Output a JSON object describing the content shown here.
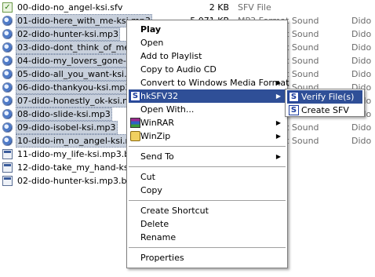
{
  "files": [
    {
      "name": "00-dido-no_angel-ksi.sfv",
      "size": "2 KB",
      "type": "SFV File",
      "artist": "",
      "icon": "sfv-file-icon",
      "selected": false
    },
    {
      "name": "01-dido-here_with_me-ksi.mp3",
      "size": "5,071 KB",
      "type": "MP3 Format Sound",
      "artist": "Dido",
      "icon": "sound-file-icon",
      "selected": true
    },
    {
      "name": "02-dido-hunter-ksi.mp3",
      "size": "",
      "type": "MP3 Format Sound",
      "artist": "Dido",
      "icon": "sound-file-icon",
      "selected": true
    },
    {
      "name": "03-dido-dont_think_of_me-ksi",
      "size": "",
      "type": "MP3 Format Sound",
      "artist": "Dido",
      "icon": "sound-file-icon",
      "selected": true
    },
    {
      "name": "04-dido-my_lovers_gone-ksi.",
      "size": "",
      "type": "MP3 Format Sound",
      "artist": "Dido",
      "icon": "sound-file-icon",
      "selected": true
    },
    {
      "name": "05-dido-all_you_want-ksi.mp",
      "size": "",
      "type": "MP3 Format Sound",
      "artist": "Dido",
      "icon": "sound-file-icon",
      "selected": true
    },
    {
      "name": "06-dido-thankyou-ksi.mp3",
      "size": "",
      "type": "MP3 Format Sound",
      "artist": "Dido",
      "icon": "sound-file-icon",
      "selected": true
    },
    {
      "name": "07-dido-honestly_ok-ksi.mp3",
      "size": "",
      "type": "MP3 Format Sound",
      "artist": "Dido",
      "icon": "sound-file-icon",
      "selected": true
    },
    {
      "name": "08-dido-slide-ksi.mp3",
      "size": "",
      "type": "MP3 Format Sound",
      "artist": "Dido",
      "icon": "sound-file-icon",
      "selected": true
    },
    {
      "name": "09-dido-isobel-ksi.mp3",
      "size": "",
      "type": "MP3 Format Sound",
      "artist": "Dido",
      "icon": "sound-file-icon",
      "selected": true
    },
    {
      "name": "10-dido-im_no_angel-ksi.mp3",
      "size": "",
      "type": "MP3 Format Sound",
      "artist": "Dido",
      "icon": "sound-file-icon",
      "selected": true
    },
    {
      "name": "11-dido-my_life-ksi.mp3.bad",
      "size": "",
      "type": "",
      "artist": "",
      "icon": "bad-file-icon",
      "selected": false
    },
    {
      "name": "12-dido-take_my_hand-ksi.mp",
      "size": "",
      "type": "",
      "artist": "",
      "icon": "bad-file-icon",
      "selected": false
    },
    {
      "name": "02-dido-hunter-ksi.mp3.bad",
      "size": "",
      "type": "",
      "artist": "",
      "icon": "bad-file-icon",
      "selected": false
    }
  ],
  "menu": {
    "items": [
      {
        "kind": "item",
        "label": "Play",
        "bold": true,
        "arrow": false,
        "icon": ""
      },
      {
        "kind": "item",
        "label": "Open",
        "arrow": false,
        "icon": ""
      },
      {
        "kind": "item",
        "label": "Add to Playlist",
        "arrow": false,
        "icon": ""
      },
      {
        "kind": "item",
        "label": "Copy to Audio CD",
        "arrow": false,
        "icon": ""
      },
      {
        "kind": "item",
        "label": "Convert to Windows Media Format",
        "arrow": true,
        "icon": ""
      },
      {
        "kind": "item",
        "label": "hkSFV32",
        "arrow": true,
        "icon": "hksfv-icon",
        "highlighted": true
      },
      {
        "kind": "item",
        "label": "Open With...",
        "arrow": false,
        "icon": ""
      },
      {
        "kind": "item",
        "label": "WinRAR",
        "arrow": true,
        "icon": "winrar-icon"
      },
      {
        "kind": "item",
        "label": "WinZip",
        "arrow": true,
        "icon": "winzip-icon"
      },
      {
        "kind": "sep"
      },
      {
        "kind": "item",
        "label": "Send To",
        "arrow": true,
        "icon": ""
      },
      {
        "kind": "sep"
      },
      {
        "kind": "item",
        "label": "Cut",
        "arrow": false,
        "icon": ""
      },
      {
        "kind": "item",
        "label": "Copy",
        "arrow": false,
        "icon": ""
      },
      {
        "kind": "sep"
      },
      {
        "kind": "item",
        "label": "Create Shortcut",
        "arrow": false,
        "icon": ""
      },
      {
        "kind": "item",
        "label": "Delete",
        "arrow": false,
        "icon": ""
      },
      {
        "kind": "item",
        "label": "Rename",
        "arrow": false,
        "icon": ""
      },
      {
        "kind": "sep"
      },
      {
        "kind": "item",
        "label": "Properties",
        "arrow": false,
        "icon": ""
      }
    ]
  },
  "submenu": {
    "items": [
      {
        "label": "Verify File(s)",
        "icon": "hksfv-icon",
        "highlighted": true
      },
      {
        "label": "Create SFV",
        "icon": "hksfv-icon",
        "highlighted": false
      }
    ]
  },
  "icons": {
    "hksfv_glyph": "S",
    "sfv_glyph": "✓",
    "arrow_glyph": "▶"
  },
  "colors": {
    "highlight": "#2f4f97",
    "selection": "#c8d0dc"
  }
}
